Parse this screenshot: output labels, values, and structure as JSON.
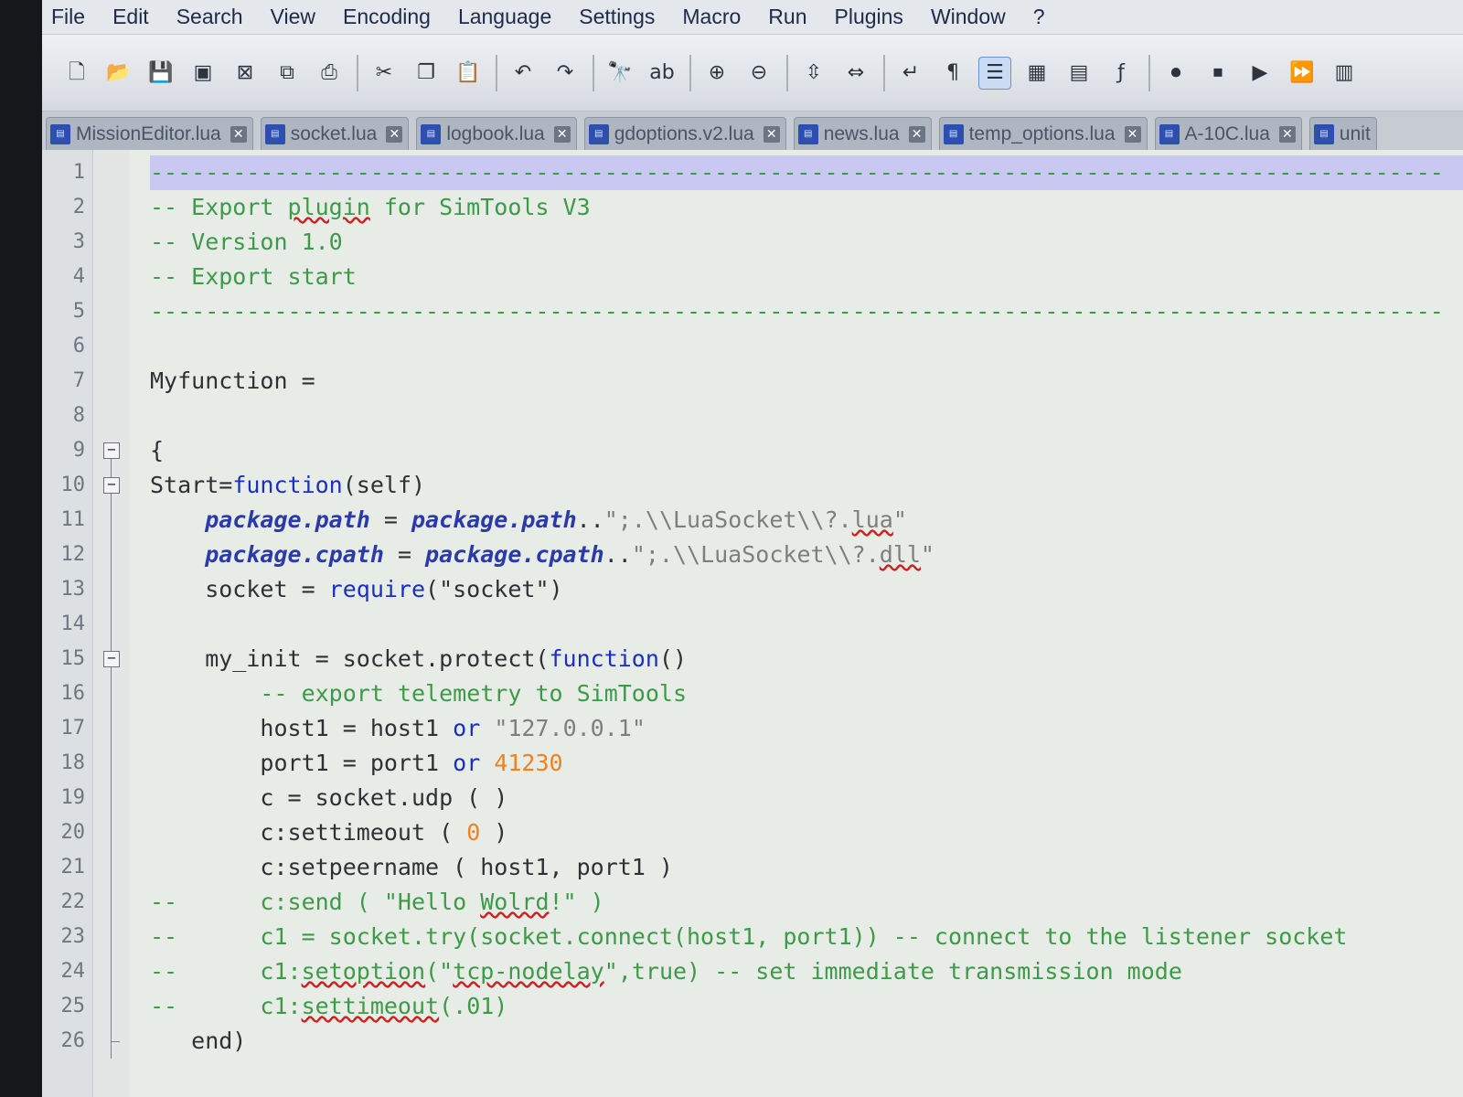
{
  "menu": [
    "File",
    "Edit",
    "Search",
    "View",
    "Encoding",
    "Language",
    "Settings",
    "Macro",
    "Run",
    "Plugins",
    "Window",
    "?"
  ],
  "toolbar": {
    "buttons": [
      {
        "name": "new-file-icon",
        "glyph": "🗋"
      },
      {
        "name": "open-file-icon",
        "glyph": "📂"
      },
      {
        "name": "save-icon",
        "glyph": "💾"
      },
      {
        "name": "save-all-icon",
        "glyph": "▣"
      },
      {
        "name": "close-icon",
        "glyph": "⊠"
      },
      {
        "name": "close-all-icon",
        "glyph": "⧉"
      },
      {
        "name": "print-icon",
        "glyph": "⎙"
      },
      {
        "sep": true
      },
      {
        "name": "cut-icon",
        "glyph": "✂"
      },
      {
        "name": "copy-icon",
        "glyph": "❐"
      },
      {
        "name": "paste-icon",
        "glyph": "📋"
      },
      {
        "sep": true
      },
      {
        "name": "undo-icon",
        "glyph": "↶"
      },
      {
        "name": "redo-icon",
        "glyph": "↷"
      },
      {
        "sep": true
      },
      {
        "name": "find-icon",
        "glyph": "🔭"
      },
      {
        "name": "replace-icon",
        "glyph": "ab"
      },
      {
        "sep": true
      },
      {
        "name": "zoom-in-icon",
        "glyph": "⊕"
      },
      {
        "name": "zoom-out-icon",
        "glyph": "⊖"
      },
      {
        "sep": true
      },
      {
        "name": "sync-vertical-icon",
        "glyph": "⇳"
      },
      {
        "name": "sync-horizontal-icon",
        "glyph": "⇔"
      },
      {
        "sep": true
      },
      {
        "name": "word-wrap-icon",
        "glyph": "↵"
      },
      {
        "name": "show-all-chars-icon",
        "glyph": "¶"
      },
      {
        "name": "indent-guide-icon",
        "glyph": "☰",
        "active": true
      },
      {
        "name": "doc-map-icon",
        "glyph": "▦"
      },
      {
        "name": "function-list-icon",
        "glyph": "▤"
      },
      {
        "name": "folder-workspace-icon",
        "glyph": "ƒ"
      },
      {
        "sep": true
      },
      {
        "name": "macro-record-icon",
        "glyph": "⏺"
      },
      {
        "name": "macro-stop-icon",
        "glyph": "⏹"
      },
      {
        "name": "macro-play-icon",
        "glyph": "▶"
      },
      {
        "name": "macro-run-multiple-icon",
        "glyph": "⏩"
      },
      {
        "name": "macro-save-icon",
        "glyph": "▥"
      }
    ]
  },
  "tabs": [
    {
      "label": "MissionEditor.lua",
      "active": false
    },
    {
      "label": "socket.lua",
      "active": false
    },
    {
      "label": "logbook.lua",
      "active": false
    },
    {
      "label": "gdoptions.v2.lua",
      "active": false
    },
    {
      "label": "news.lua",
      "active": false
    },
    {
      "label": "temp_options.lua",
      "active": false
    },
    {
      "label": "A-10C.lua",
      "active": false
    },
    {
      "label": "unit",
      "active": false
    }
  ],
  "code_lines": [
    {
      "n": "1",
      "fold": "",
      "highlight": true,
      "tokens": [
        [
          "cmt",
          "----------------------------------------------------------------------------------------------"
        ]
      ]
    },
    {
      "n": "2",
      "fold": "",
      "tokens": [
        [
          "cmt",
          "-- Export "
        ],
        [
          "cmt sq",
          "plugin"
        ],
        [
          "cmt",
          " for SimTools V3"
        ]
      ]
    },
    {
      "n": "3",
      "fold": "",
      "tokens": [
        [
          "cmt",
          "-- Version 1.0"
        ]
      ]
    },
    {
      "n": "4",
      "fold": "",
      "tokens": [
        [
          "cmt",
          "-- Export start"
        ]
      ]
    },
    {
      "n": "5",
      "fold": "",
      "tokens": [
        [
          "cmt",
          "----------------------------------------------------------------------------------------------"
        ]
      ]
    },
    {
      "n": "6",
      "fold": "",
      "tokens": []
    },
    {
      "n": "7",
      "fold": "",
      "tokens": [
        [
          "",
          "Myfunction ="
        ]
      ]
    },
    {
      "n": "8",
      "fold": "",
      "tokens": []
    },
    {
      "n": "9",
      "fold": "box",
      "tokens": [
        [
          "",
          "{"
        ]
      ]
    },
    {
      "n": "10",
      "fold": "box",
      "tokens": [
        [
          "",
          "Start="
        ],
        [
          "kw",
          "function"
        ],
        [
          "",
          "(self)"
        ]
      ]
    },
    {
      "n": "11",
      "fold": "line",
      "tokens": [
        [
          "",
          "    "
        ],
        [
          "bi",
          "package.path"
        ],
        [
          "",
          " = "
        ],
        [
          "bi",
          "package.path"
        ],
        [
          "",
          ".."
        ],
        [
          "str",
          "\";.\\\\LuaSocket\\\\?."
        ],
        [
          "str sq",
          "lua"
        ],
        [
          "str",
          "\""
        ]
      ]
    },
    {
      "n": "12",
      "fold": "line",
      "tokens": [
        [
          "",
          "    "
        ],
        [
          "bi",
          "package.cpath"
        ],
        [
          "",
          " = "
        ],
        [
          "bi",
          "package.cpath"
        ],
        [
          "",
          ".."
        ],
        [
          "str",
          "\";.\\\\LuaSocket\\\\?."
        ],
        [
          "str sq",
          "dll"
        ],
        [
          "str",
          "\""
        ]
      ]
    },
    {
      "n": "13",
      "fold": "line",
      "tokens": [
        [
          "",
          "    socket = "
        ],
        [
          "kw",
          "require"
        ],
        [
          "",
          "(\"socket\")"
        ]
      ]
    },
    {
      "n": "14",
      "fold": "line",
      "tokens": []
    },
    {
      "n": "15",
      "fold": "box",
      "tokens": [
        [
          "",
          "    my_init = socket.protect("
        ],
        [
          "kw",
          "function"
        ],
        [
          "",
          "()"
        ]
      ]
    },
    {
      "n": "16",
      "fold": "line",
      "tokens": [
        [
          "",
          "        "
        ],
        [
          "cmt",
          "-- export telemetry to SimTools"
        ]
      ]
    },
    {
      "n": "17",
      "fold": "line",
      "tokens": [
        [
          "",
          "        host1 = host1 "
        ],
        [
          "kw",
          "or"
        ],
        [
          "",
          " "
        ],
        [
          "str",
          "\"127.0.0.1\""
        ]
      ]
    },
    {
      "n": "18",
      "fold": "line",
      "tokens": [
        [
          "",
          "        port1 = port1 "
        ],
        [
          "kw",
          "or"
        ],
        [
          "",
          " "
        ],
        [
          "num",
          "41230"
        ]
      ]
    },
    {
      "n": "19",
      "fold": "line",
      "tokens": [
        [
          "",
          "        c = socket.udp ( )"
        ]
      ]
    },
    {
      "n": "20",
      "fold": "line",
      "tokens": [
        [
          "",
          "        c:settimeout ( "
        ],
        [
          "num",
          "0"
        ],
        [
          "",
          " )"
        ]
      ]
    },
    {
      "n": "21",
      "fold": "line",
      "tokens": [
        [
          "",
          "        c:setpeername ( host1, port1 )"
        ]
      ]
    },
    {
      "n": "22",
      "fold": "line",
      "tokens": [
        [
          "cmt",
          "--      c:send ( \"Hello "
        ],
        [
          "cmt sq",
          "Wolrd"
        ],
        [
          "cmt",
          "!\" )"
        ]
      ]
    },
    {
      "n": "23",
      "fold": "line",
      "tokens": [
        [
          "cmt",
          "--      c1 = socket.try(socket.connect(host1, port1)) -- connect to the listener socket"
        ]
      ]
    },
    {
      "n": "24",
      "fold": "line",
      "tokens": [
        [
          "cmt",
          "--      c1:"
        ],
        [
          "cmt sq",
          "setoption"
        ],
        [
          "cmt",
          "(\""
        ],
        [
          "cmt sq",
          "tcp-nodelay"
        ],
        [
          "cmt",
          "\",true) -- set immediate transmission mode"
        ]
      ]
    },
    {
      "n": "25",
      "fold": "line",
      "tokens": [
        [
          "cmt",
          "--      c1:"
        ],
        [
          "cmt sq",
          "settimeout"
        ],
        [
          "cmt",
          "(.01)"
        ]
      ]
    },
    {
      "n": "26",
      "fold": "end",
      "tokens": [
        [
          "",
          "   end)"
        ]
      ]
    }
  ]
}
